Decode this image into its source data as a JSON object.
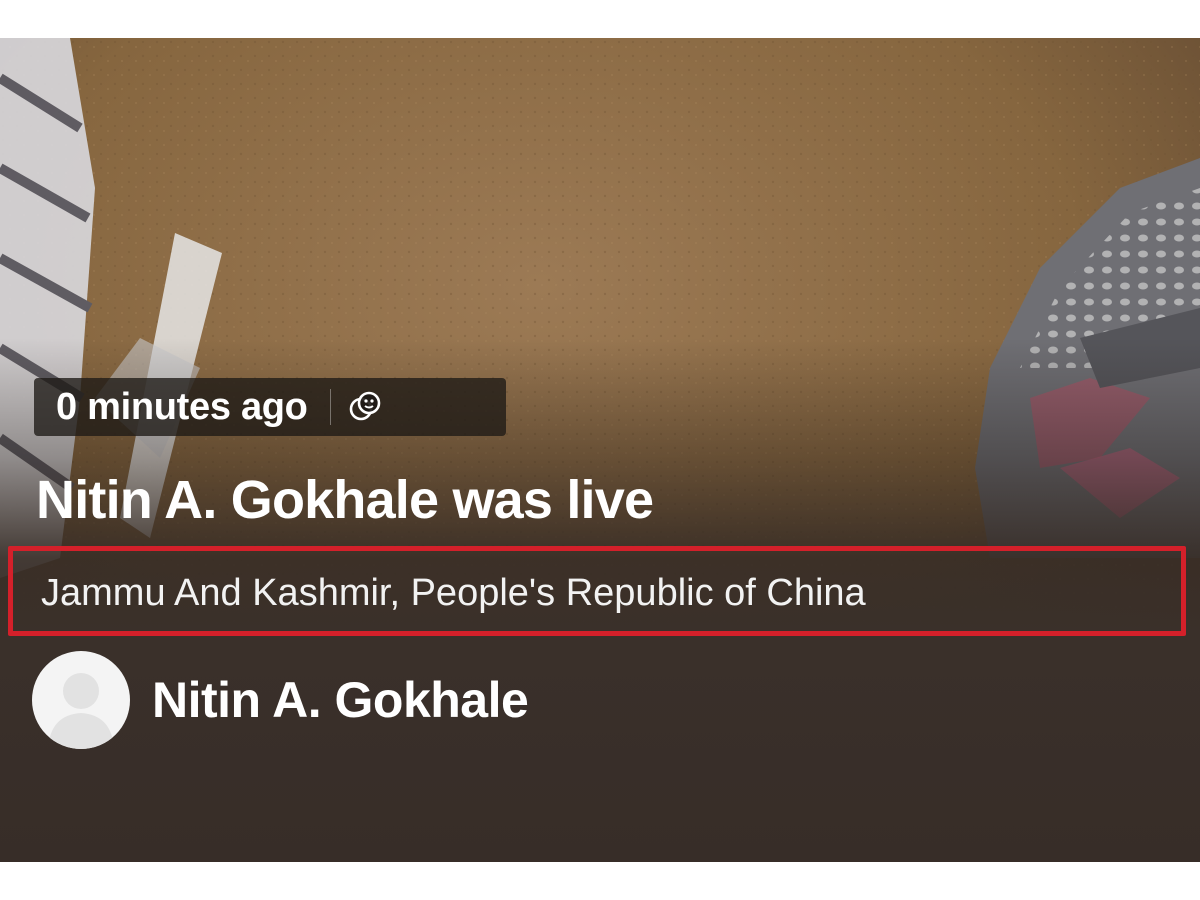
{
  "post": {
    "time_ago": "0 minutes ago",
    "audience_icon": "friends-audience-icon",
    "headline": "Nitin A. Gokhale was live",
    "location": "Jammu And Kashmir, People's Republic of China",
    "author_name": "Nitin A. Gokhale"
  },
  "colors": {
    "highlight_border": "#d4202a",
    "floor_brown": "#8a6a48",
    "overlay_dark": "#3a302a"
  }
}
